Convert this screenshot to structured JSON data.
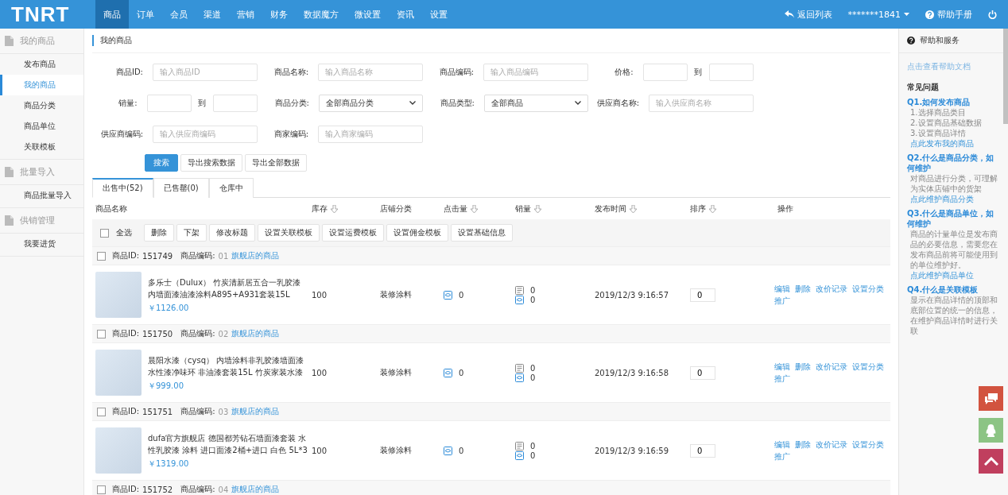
{
  "topbar": {
    "logo": "TNRT",
    "nav": [
      {
        "label": "商品",
        "selected": true
      },
      {
        "label": "订单",
        "selected": false
      },
      {
        "label": "会员",
        "selected": false
      },
      {
        "label": "渠道",
        "selected": false
      },
      {
        "label": "营销",
        "selected": false
      },
      {
        "label": "财务",
        "selected": false
      },
      {
        "label": "数据魔方",
        "selected": false
      },
      {
        "label": "微设置",
        "selected": false
      },
      {
        "label": "资讯",
        "selected": false
      },
      {
        "label": "设置",
        "selected": false
      }
    ],
    "back": "返回列表",
    "user": "*******1841",
    "help": "帮助手册"
  },
  "sidebar": {
    "groups": [
      {
        "title": "我的商品",
        "items": [
          {
            "label": "发布商品",
            "selected": false
          },
          {
            "label": "我的商品",
            "selected": true
          },
          {
            "label": "商品分类",
            "selected": false
          },
          {
            "label": "商品单位",
            "selected": false
          },
          {
            "label": "关联模板",
            "selected": false
          }
        ]
      },
      {
        "title": "批量导入",
        "items": [
          {
            "label": "商品批量导入",
            "selected": false
          }
        ]
      },
      {
        "title": "供销管理",
        "items": [
          {
            "label": "我要进货",
            "selected": false
          }
        ]
      }
    ]
  },
  "page_title": "我的商品",
  "filters": [
    [
      {
        "kind": "input",
        "label": "商品ID:",
        "placeholder": "输入商品ID"
      },
      {
        "kind": "input",
        "label": "商品名称:",
        "placeholder": "输入商品名称"
      },
      {
        "kind": "input",
        "label": "商品编码:",
        "placeholder": "输入商品编码"
      },
      {
        "kind": "range",
        "label": "价格:",
        "separator": "到"
      }
    ],
    [
      {
        "kind": "range",
        "label": "销量:",
        "separator": "到"
      },
      {
        "kind": "select",
        "label": "商品分类:",
        "value": "全部商品分类"
      },
      {
        "kind": "select",
        "label": "商品类型:",
        "value": "全部商品"
      },
      {
        "kind": "input",
        "label": "供应商名称:",
        "placeholder": "输入供应商名称"
      }
    ],
    [
      {
        "kind": "input",
        "label": "供应商编码:",
        "placeholder": "输入供应商编码"
      },
      {
        "kind": "input",
        "label": "商家编码:",
        "placeholder": "输入商家编码"
      }
    ]
  ],
  "filter_buttons": [
    {
      "label": "搜索",
      "primary": true
    },
    {
      "label": "导出搜索数据",
      "primary": false
    },
    {
      "label": "导出全部数据",
      "primary": false
    }
  ],
  "tabs": [
    {
      "label": "出售中(52)",
      "selected": true
    },
    {
      "label": "已售罄(0)",
      "selected": false
    },
    {
      "label": "仓库中",
      "selected": false
    }
  ],
  "table": {
    "columns": [
      {
        "label": "商品名称",
        "sortable": false
      },
      {
        "label": "库存",
        "sortable": true
      },
      {
        "label": "店铺分类",
        "sortable": false
      },
      {
        "label": "点击量",
        "sortable": true
      },
      {
        "label": "销量",
        "sortable": true
      },
      {
        "label": "发布时间",
        "sortable": true
      },
      {
        "label": "排序",
        "sortable": true
      },
      {
        "label": "操作",
        "sortable": false
      }
    ],
    "select_all": {
      "label": "全选",
      "checked": false
    },
    "batch_buttons": [
      "删除",
      "下架",
      "修改标题",
      "设置关联模板",
      "设置运费模板",
      "设置佣金模板",
      "设置基础信息"
    ],
    "rows": [
      {
        "checked": false,
        "id_label": "商品ID:",
        "id": "151749",
        "code_label": "商品编码:",
        "code": "01",
        "store": "旗舰店的商品",
        "name": "多乐士（Dulux） 竹炭清新居五合一乳胶漆内墙面漆油漆涂料A895+A931套装15L",
        "price": "￥1126.00",
        "stock": "100",
        "category": "装修涂料",
        "clicks": "0",
        "sales_a": "0",
        "sales_b": "0",
        "time": "2019/12/3 9:16:57",
        "sort": "0",
        "actions": [
          "编辑",
          "删除",
          "改价记录",
          "设置分类",
          "推广"
        ]
      },
      {
        "checked": false,
        "id_label": "商品ID:",
        "id": "151750",
        "code_label": "商品编码:",
        "code": "02",
        "store": "旗舰店的商品",
        "name": "晨阳水漆（cysq） 内墙涂料非乳胶漆墙面漆水性漆净味环 非油漆套装15L 竹炭家装水漆",
        "price": "￥999.00",
        "stock": "100",
        "category": "装修涂料",
        "clicks": "0",
        "sales_a": "0",
        "sales_b": "0",
        "time": "2019/12/3 9:16:58",
        "sort": "0",
        "actions": [
          "编辑",
          "删除",
          "改价记录",
          "设置分类",
          "推广"
        ]
      },
      {
        "checked": false,
        "id_label": "商品ID:",
        "id": "151751",
        "code_label": "商品编码:",
        "code": "03",
        "store": "旗舰店的商品",
        "name": "dufa官方旗舰店 德国都芳钻石墙面漆套装 水性乳胶漆 涂料 进口面漆2桶+进口 白色 5L*3",
        "price": "￥1319.00",
        "stock": "100",
        "category": "装修涂料",
        "clicks": "0",
        "sales_a": "0",
        "sales_b": "0",
        "time": "2019/12/3 9:16:59",
        "sort": "0",
        "actions": [
          "编辑",
          "删除",
          "改价记录",
          "设置分类",
          "推广"
        ]
      },
      {
        "checked": false,
        "id_label": "商品ID:",
        "id": "151752",
        "code_label": "商品编码:",
        "code": "04",
        "store": "旗舰店的商品"
      }
    ]
  },
  "help": {
    "title": "帮助和服务",
    "doc_link": "点击查看帮助文档",
    "faq_title": "常见问题",
    "questions": [
      {
        "title": "Q1.如何发布商品",
        "lines": [
          "1.选择商品类目",
          "2.设置商品基础数据",
          "3.设置商品详情"
        ],
        "link": "点此发布我的商品"
      },
      {
        "title": "Q2.什么是商品分类，如何维护",
        "lines": [
          "对商品进行分类，可理解为实体店铺中的货架"
        ],
        "link": "点此维护商品分类"
      },
      {
        "title": "Q3.什么是商品单位，如何维护",
        "lines": [
          "商品的计量单位是发布商品的必要信息，需要您在发布商品前将可能使用到的单位维护好。"
        ],
        "link": "点此维护商品单位"
      },
      {
        "title": "Q4.什么是关联模板",
        "lines": [
          "显示在商品详情的顶部和底部位置的统一的信息，在维护商品详情时进行关联"
        ]
      }
    ]
  }
}
